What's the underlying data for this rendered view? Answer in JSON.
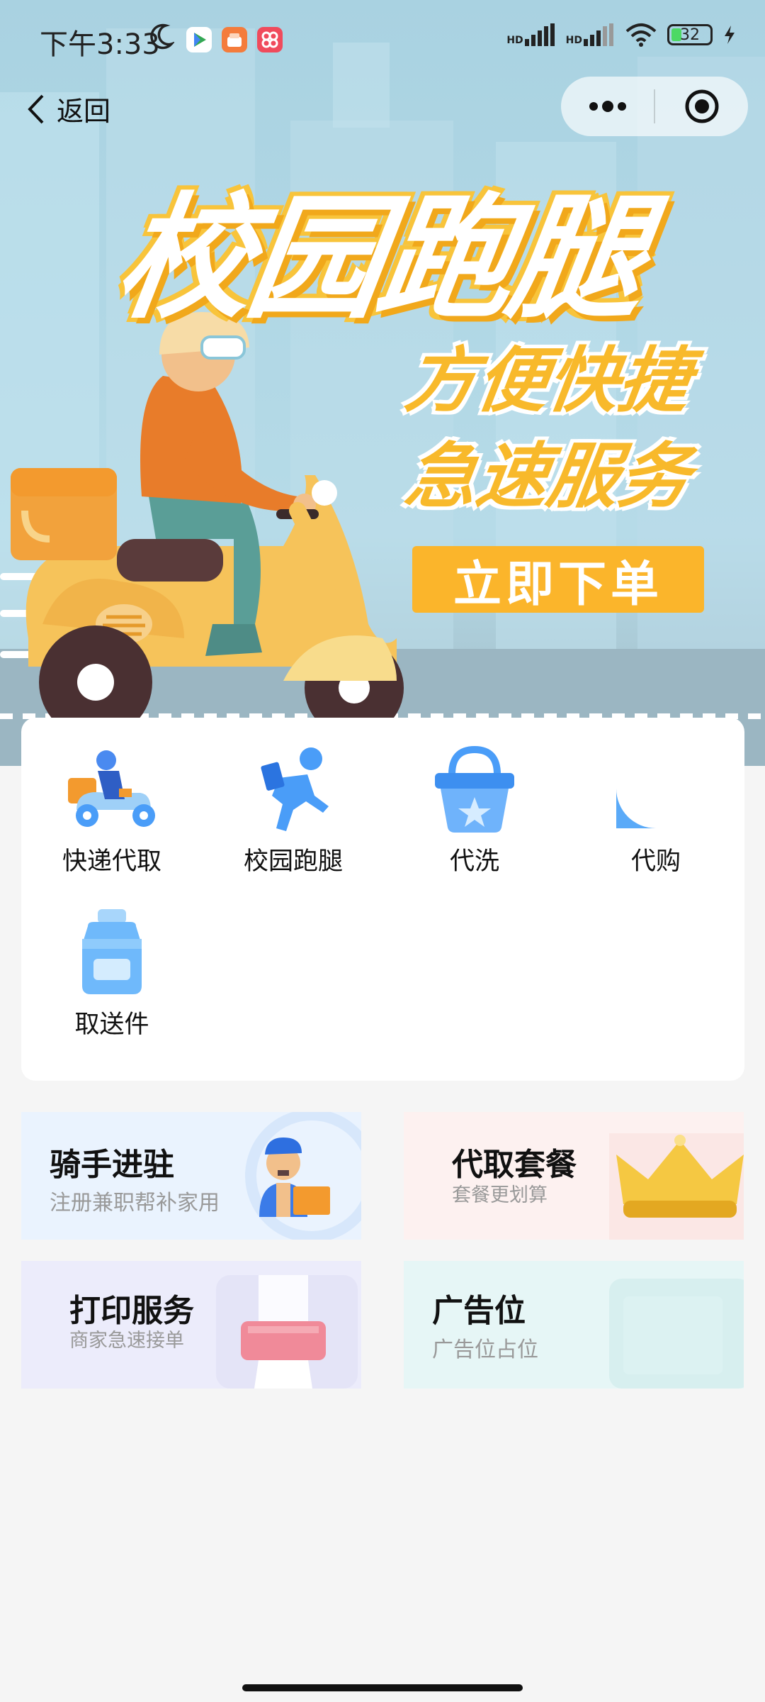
{
  "status_bar": {
    "time": "下午3:33",
    "hd1": "HD",
    "hd2": "HD",
    "battery": "32"
  },
  "nav": {
    "back_label": "返回"
  },
  "banner": {
    "title": "校园跑腿",
    "sub1": "方便快捷",
    "sub2": "急速服务",
    "cta": "立即下单"
  },
  "services": [
    {
      "label": "快递代取"
    },
    {
      "label": "校园跑腿"
    },
    {
      "label": "代洗"
    },
    {
      "label": "代购"
    },
    {
      "label": "取送件"
    }
  ],
  "tiles": {
    "rider": {
      "title": "骑手进驻",
      "subtitle": "注册兼职帮补家用"
    },
    "package": {
      "title": "代取套餐",
      "subtitle": "套餐更划算"
    },
    "print": {
      "title": "打印服务",
      "subtitle": "商家急速接单"
    },
    "ad": {
      "title": "广告位",
      "subtitle": "广告位占位"
    }
  },
  "colors": {
    "accent_blue": "#4a9df8",
    "banner_yellow": "#fbb52b",
    "rider_bg": "#eaf3fe",
    "package_bg": "#fdf1f0",
    "print_bg": "#ececfb",
    "ad_bg": "#e6f6f6"
  }
}
